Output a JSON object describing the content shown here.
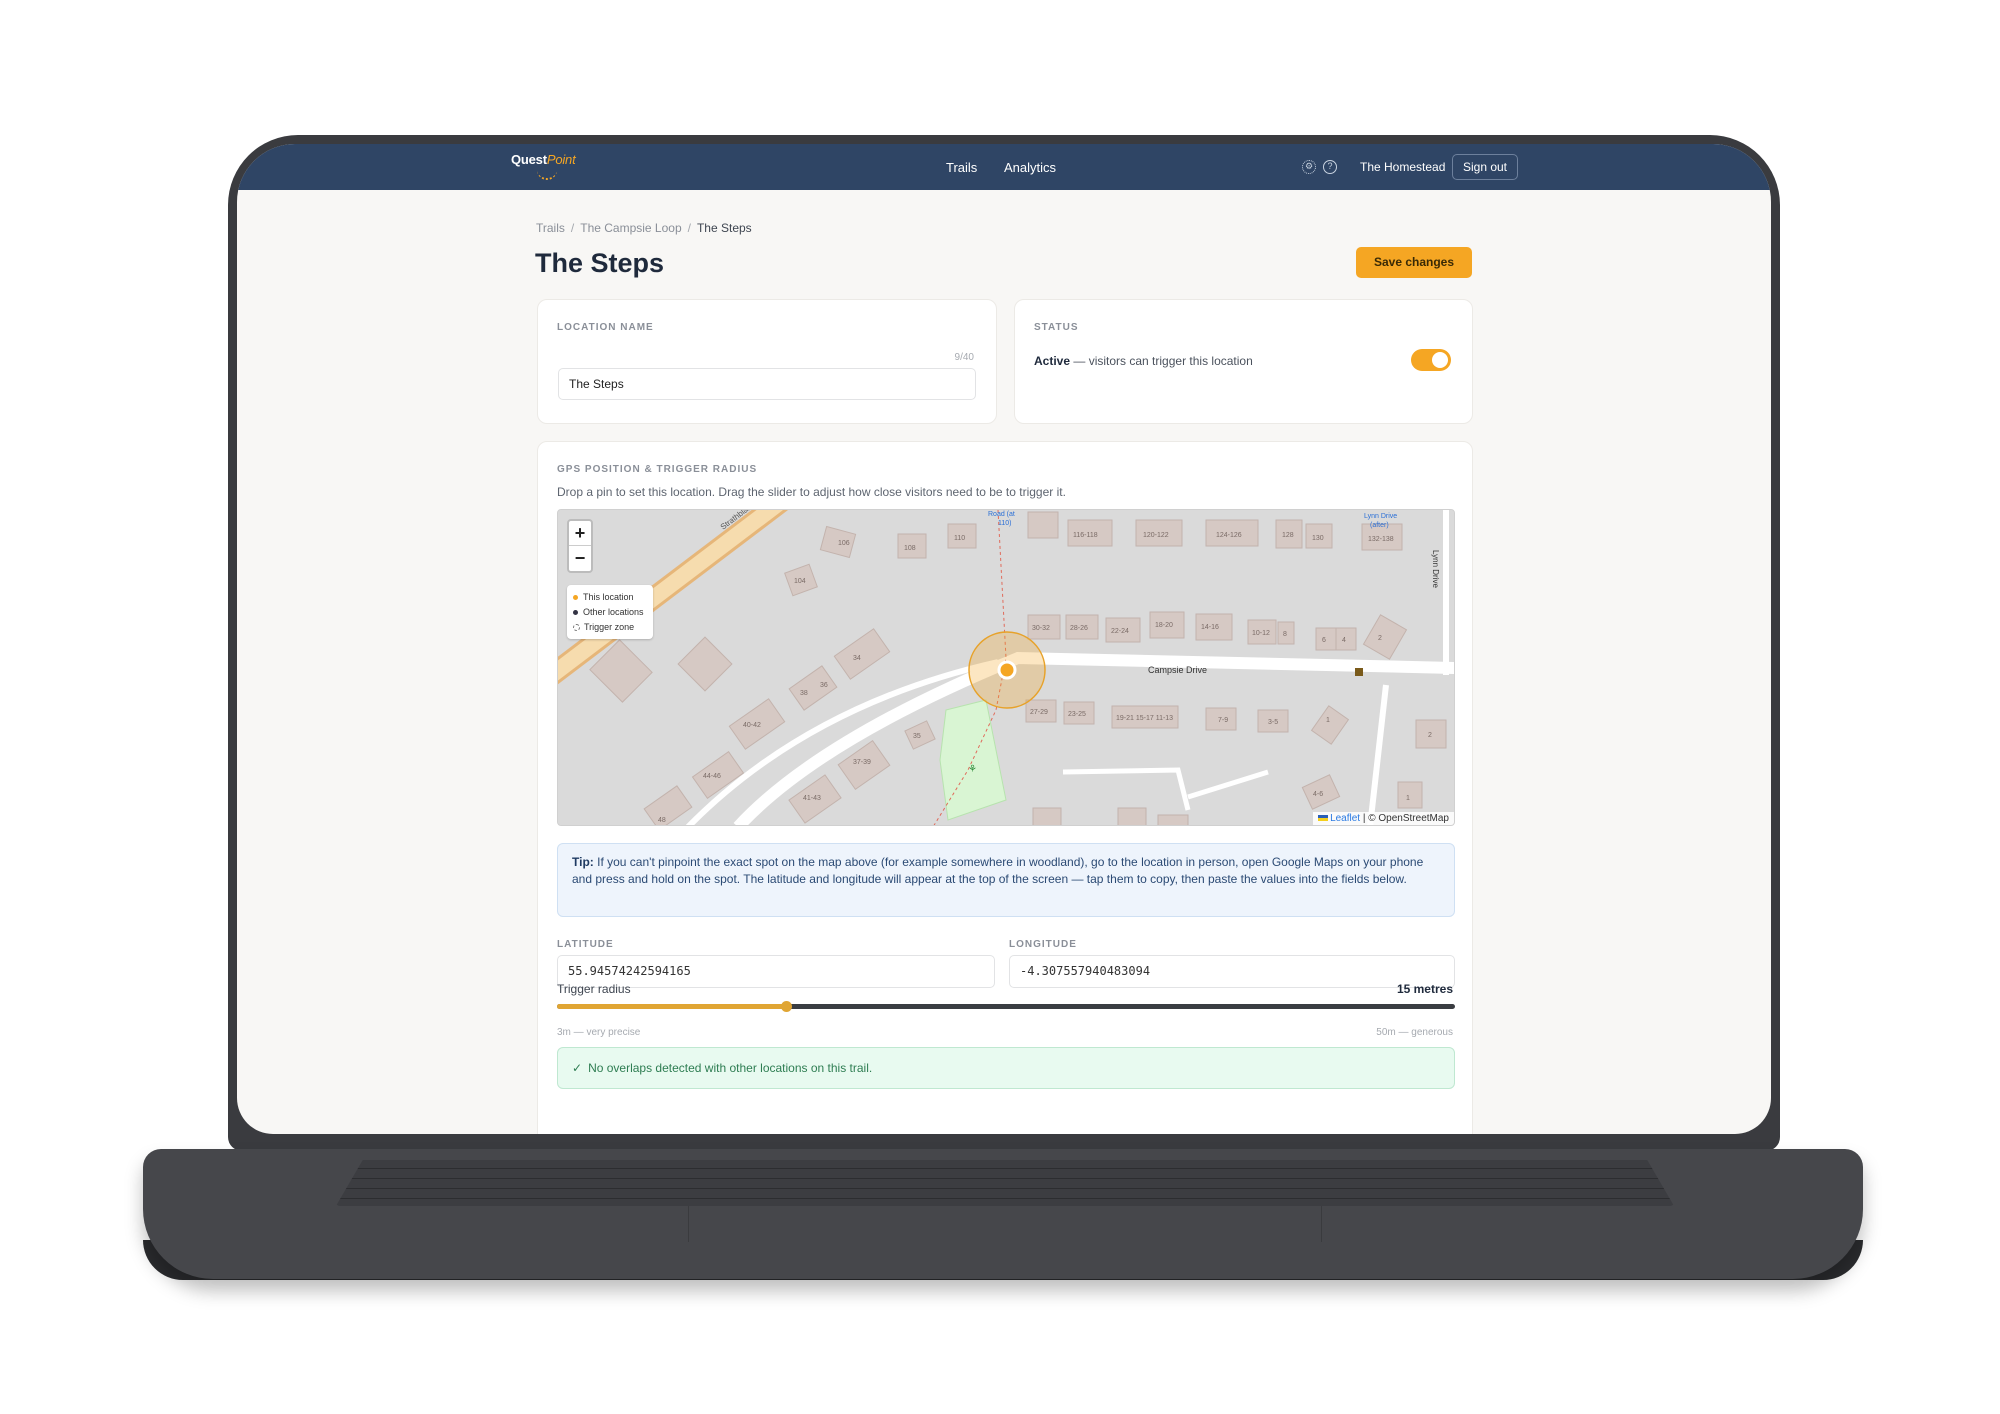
{
  "nav": {
    "logo_main": "Quest",
    "logo_accent": "Point",
    "links": [
      "Trails",
      "Analytics"
    ],
    "account_name": "The Homestead",
    "signout_label": "Sign out"
  },
  "breadcrumb": [
    "Trails",
    "The Campsie Loop",
    "The Steps"
  ],
  "page_title": "The Steps",
  "save_label": "Save changes",
  "location_name": {
    "label": "LOCATION NAME",
    "counter": "9/40",
    "value": "The Steps"
  },
  "status": {
    "label": "STATUS",
    "state": "Active",
    "description": " — visitors can trigger this location",
    "enabled": true
  },
  "gps": {
    "label": "GPS POSITION & TRIGGER RADIUS",
    "description": "Drop a pin to set this location. Drag the slider to adjust how close visitors need to be to trigger it."
  },
  "map": {
    "zoom_in": "+",
    "zoom_out": "−",
    "legend": [
      "This location",
      "Other locations",
      "Trigger zone"
    ],
    "attribution_leaflet": "Leaflet",
    "attribution_osm": "| © OpenStreetMap",
    "street_labels": [
      "Strathblane Road",
      "Campsie Drive",
      "Lynn Drive",
      "Road (at 110)",
      "Lynn Drive (after) 132-138"
    ],
    "house_numbers": [
      "106",
      "108",
      "110",
      "104",
      "116-118",
      "120-122",
      "124-126",
      "128",
      "130",
      "132-138",
      "30-32",
      "28-26",
      "22-24",
      "18-20",
      "14-16",
      "10-12",
      "8",
      "6",
      "4",
      "2",
      "34",
      "36",
      "38",
      "40-42",
      "44-46",
      "48",
      "35",
      "37-39",
      "41-43",
      "27-29",
      "23-25",
      "19-21",
      "15-17",
      "11-13",
      "7-9",
      "3-5",
      "1",
      "2",
      "4-6",
      "1"
    ]
  },
  "tip": {
    "prefix": "Tip:",
    "text": " If you can't pinpoint the exact spot on the map above (for example somewhere in woodland), go to the location in person, open Google Maps on your phone and press and hold on the spot. The latitude and longitude will appear at the top of the screen — tap them to copy, then paste the values into the fields below."
  },
  "coords": {
    "latitude_label": "LATITUDE",
    "latitude": "55.94574242594165",
    "longitude_label": "LONGITUDE",
    "longitude": "-4.307557940483094"
  },
  "radius": {
    "label": "Trigger radius",
    "value_text": "15 metres",
    "value_m": 15,
    "min_m": 3,
    "max_m": 50,
    "min_label": "3m — very precise",
    "max_label": "50m — generous"
  },
  "overlap_message": "No overlaps detected with other locations on this trail.",
  "colors": {
    "navbar": "#2f4565",
    "accent": "#f5a623",
    "success_bg": "#e8faf0",
    "tip_bg": "#eef4fc"
  }
}
